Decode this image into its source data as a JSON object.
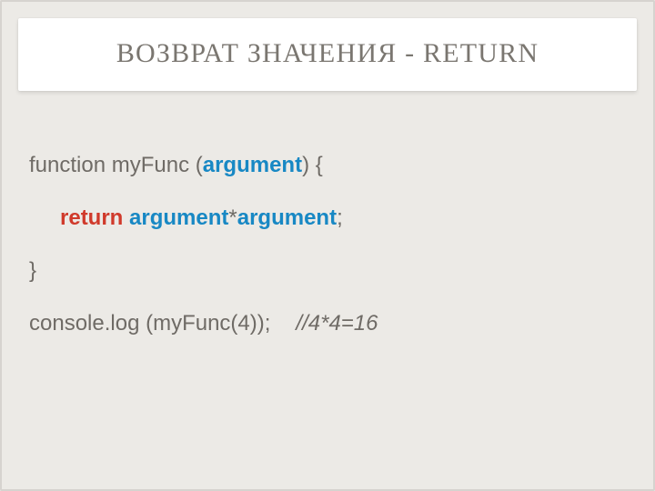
{
  "title": "ВОЗВРАТ ЗНАЧЕНИЯ - RETURN",
  "code": {
    "l1_func": "function myFunc (",
    "l1_arg": "argument",
    "l1_close": ") {",
    "l2_return": "return",
    "l2_arg1": "argument",
    "l2_star": "*",
    "l2_arg2": "argument",
    "l2_semi": ";",
    "l3_brace": "}",
    "l4_call": "console.log (myFunc(4));",
    "l4_comment": "//4*4=16"
  }
}
